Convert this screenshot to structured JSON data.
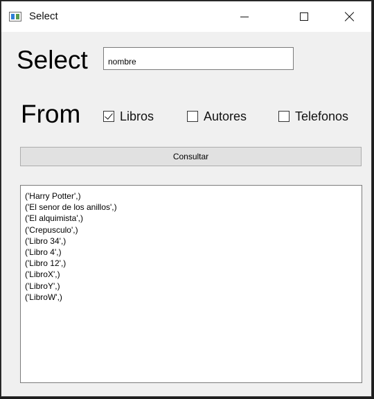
{
  "window": {
    "title": "Select"
  },
  "labels": {
    "select": "Select",
    "from": "From"
  },
  "select_input": {
    "value": "nombre"
  },
  "tables": [
    {
      "label": "Libros",
      "checked": true
    },
    {
      "label": "Autores",
      "checked": false
    },
    {
      "label": "Telefonos",
      "checked": false
    }
  ],
  "button": {
    "label": "Consultar"
  },
  "results": [
    "('Harry Potter',)",
    "('El senor de los anillos',)",
    "('El alquimista',)",
    "('Crepusculo',)",
    "('Libro 34',)",
    "('Libro 4',)",
    "('Libro 12',)",
    "('LibroX',)",
    "('LibroY',)",
    "('LibroW',)"
  ]
}
